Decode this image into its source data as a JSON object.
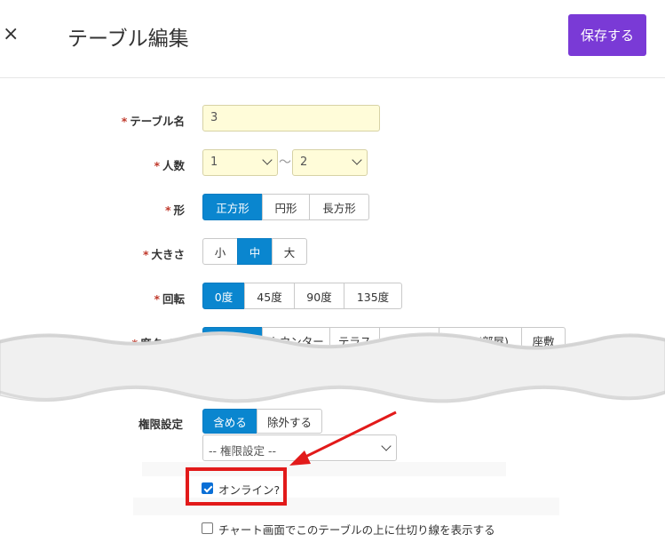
{
  "header": {
    "close_glyph": "×",
    "title": "テーブル編集",
    "save_label": "保存する"
  },
  "form": {
    "required_mark": "*",
    "table_name": {
      "label": "テーブル名",
      "value": "3"
    },
    "people": {
      "label": "人数",
      "min": "1",
      "separator": "〜",
      "max": "2"
    },
    "shape": {
      "label": "形",
      "options": [
        "正方形",
        "円形",
        "長方形"
      ],
      "selected": "正方形"
    },
    "size": {
      "label": "大きさ",
      "options": [
        "小",
        "中",
        "大"
      ],
      "selected": "中"
    },
    "rotation": {
      "label": "回転",
      "options": [
        "0度",
        "45度",
        "90度",
        "135度"
      ],
      "selected": "0度"
    },
    "seat_type": {
      "label": "席タイプ",
      "options": [
        "テーブル",
        "カウンター",
        "テラス",
        "個室 (部屋)",
        "座敷"
      ],
      "selected": "テーブル"
    },
    "permission": {
      "label": "権限設定",
      "options": [
        "含める",
        "除外する"
      ],
      "selected": "含める",
      "select_placeholder": "-- 権限設定 --"
    },
    "online": {
      "label": "オンライン?",
      "checked": true
    },
    "divider": {
      "label": "チャート画面でこのテーブルの上に仕切り線を表示する",
      "checked": false
    }
  },
  "colors": {
    "accent": "#7a3ad6",
    "selected": "#0a86cf",
    "highlight": "#e21a1a",
    "input_bg": "#fffcd9"
  }
}
